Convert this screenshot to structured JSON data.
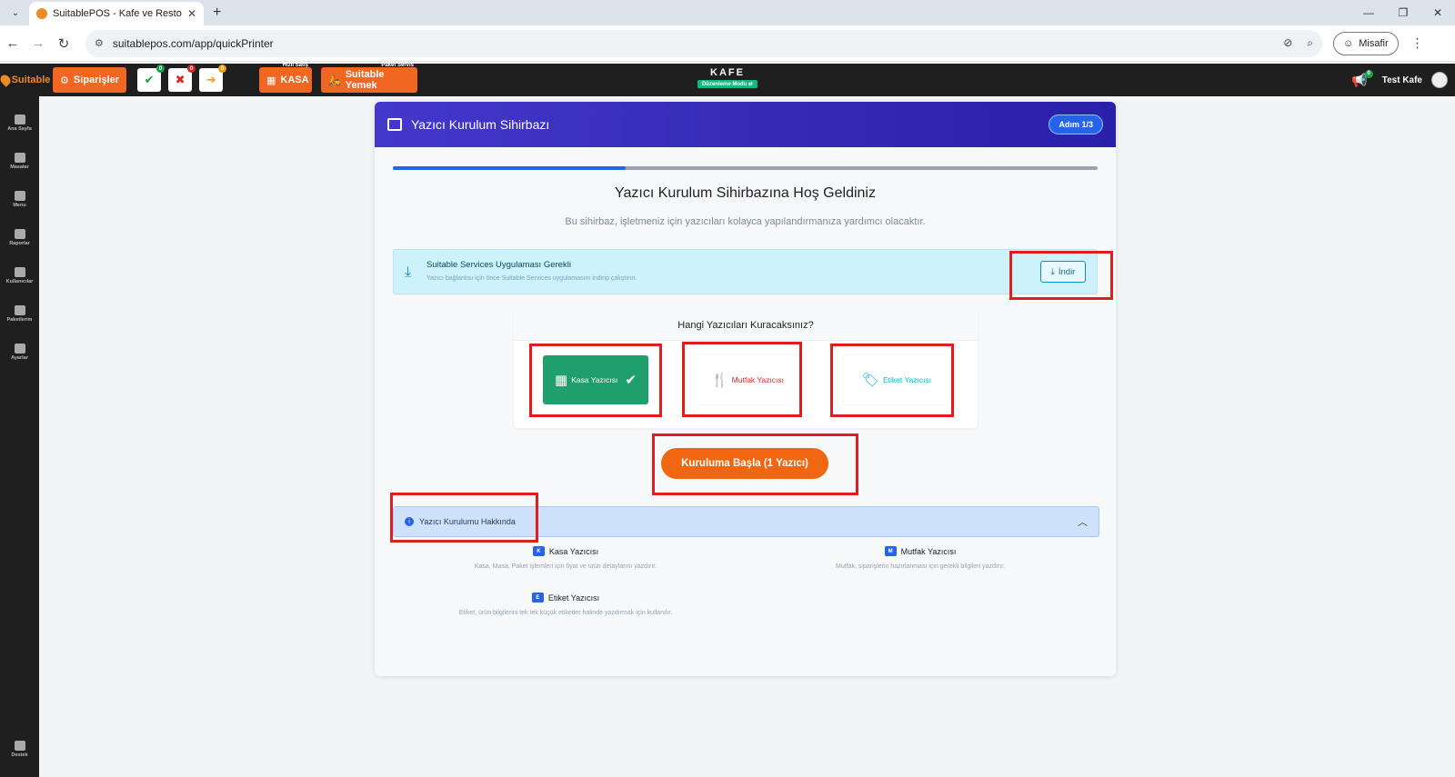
{
  "browser": {
    "tab_title": "SuitablePOS - Kafe ve Restoran",
    "url": "suitablepos.com/app/quickPrinter",
    "profile": "Misafir"
  },
  "topbar": {
    "logo": "Suitable",
    "orders_label": "Siparişler",
    "badge_green": "0",
    "badge_red": "0",
    "badge_yellow": "0",
    "quick_sale_small": "Hızlı Satış",
    "quick_sale_label": "KASA",
    "package_small": "Paket Servis",
    "package_label": "Suitable Yemek",
    "center_title": "KAFE",
    "center_mode": "Düzenleme Modu",
    "notif_count": "0",
    "user_name": "Test Kafe"
  },
  "sidebar": {
    "items": [
      {
        "label": "Ana Sayfa"
      },
      {
        "label": "Masalar"
      },
      {
        "label": "Menu"
      },
      {
        "label": "Raporlar"
      },
      {
        "label": "Kullanıcılar"
      },
      {
        "label": "Paketlerim"
      },
      {
        "label": "Ayarlar"
      }
    ],
    "support": "Destek"
  },
  "wizard": {
    "title": "Yazıcı Kurulum Sihirbazı",
    "step": "Adım 1/3",
    "progress": 0.33,
    "welcome": "Yazıcı Kurulum Sihirbazına Hoş Geldiniz",
    "subtitle": "Bu sihirbaz, işletmeniz için yazıcıları kolayca yapılandırmanıza yardımcı olacaktır.",
    "alert_title": "Suitable Services Uygulaması Gerekli",
    "alert_text": "Yazıcı bağlantısı için önce Suitable Services uygulamasını indirip çalıştırın.",
    "download_label": "İndir",
    "question": "Hangi Yazıcıları Kuracaksınız?",
    "printers": [
      {
        "label": "Kasa Yazıcısı",
        "selected": true
      },
      {
        "label": "Mutfak Yazıcısı",
        "selected": false
      },
      {
        "label": "Etiket Yazıcısı",
        "selected": false
      }
    ],
    "start_label": "Kuruluma Başla (1 Yazıcı)",
    "about_title": "Yazıcı Kurulumu Hakkında",
    "about": [
      {
        "key": "K",
        "title": "Kasa Yazıcısı",
        "desc": "Kasa, Masa, Paket işlemleri için fiyat ve ürün detaylarını yazdırır."
      },
      {
        "key": "M",
        "title": "Mutfak Yazıcısı",
        "desc": "Mutfak, siparişlerin hazırlanması için gerekli bilgileri yazdırır."
      },
      {
        "key": "E",
        "title": "Etiket Yazıcısı",
        "desc": "Etiket, ürün bilgilerini tek tek küçük etiketler halinde yazdırmak için kullanılır."
      }
    ]
  },
  "colors": {
    "accent_orange": "#f16722",
    "header_indigo": "#4338ca",
    "selected_green": "#1f9f6b",
    "highlight_red": "#e11d1d"
  }
}
